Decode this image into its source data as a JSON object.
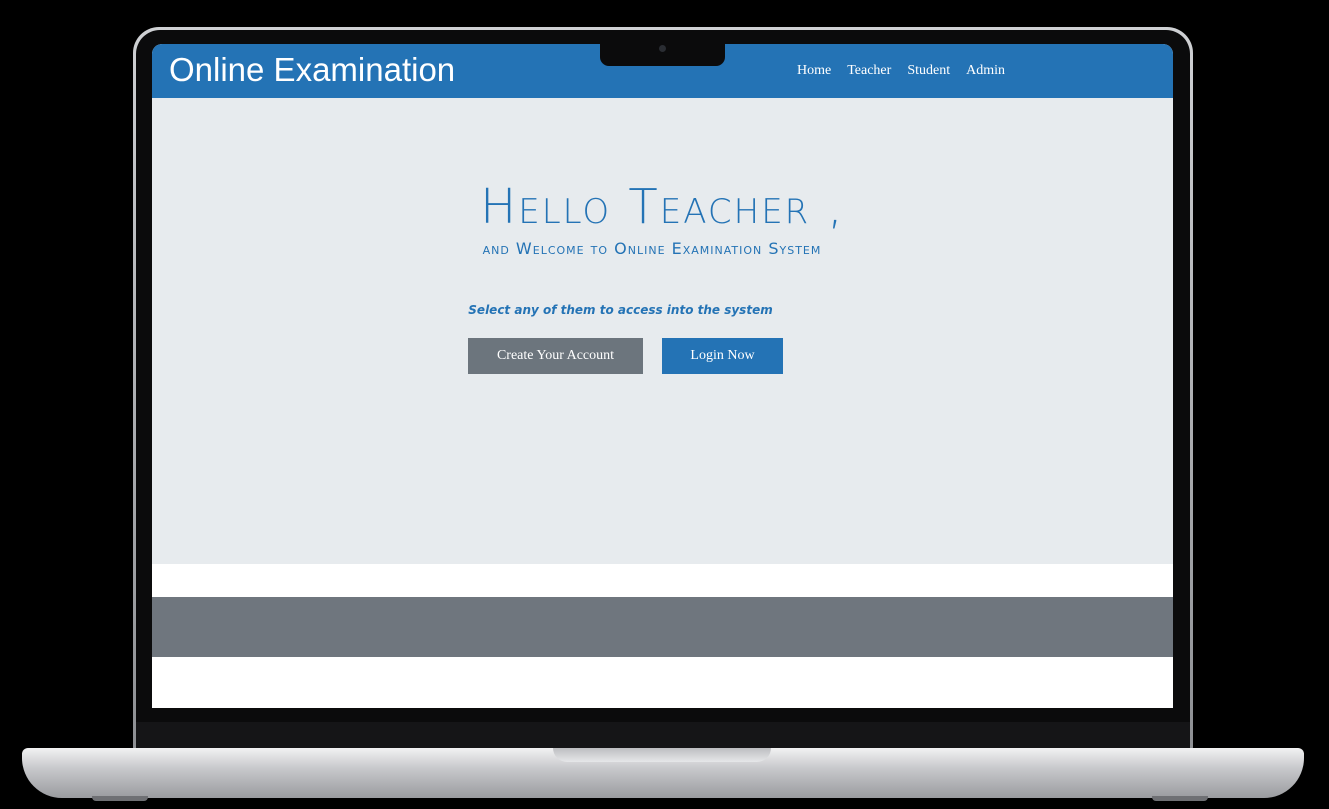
{
  "navbar": {
    "brand": "Online Examination",
    "links": [
      "Home",
      "Teacher",
      "Student",
      "Admin"
    ]
  },
  "hero": {
    "title": "Hello Teacher ,",
    "subtitle": "and Welcome to Online Examination System",
    "instruction": "Select any of them to access into the system",
    "create_button": "Create Your Account",
    "login_button": "Login Now"
  },
  "colors": {
    "primary": "#2473b5",
    "secondary": "#6c757d",
    "hero_bg": "#e7ebee",
    "footer_bg": "#6f767e"
  }
}
